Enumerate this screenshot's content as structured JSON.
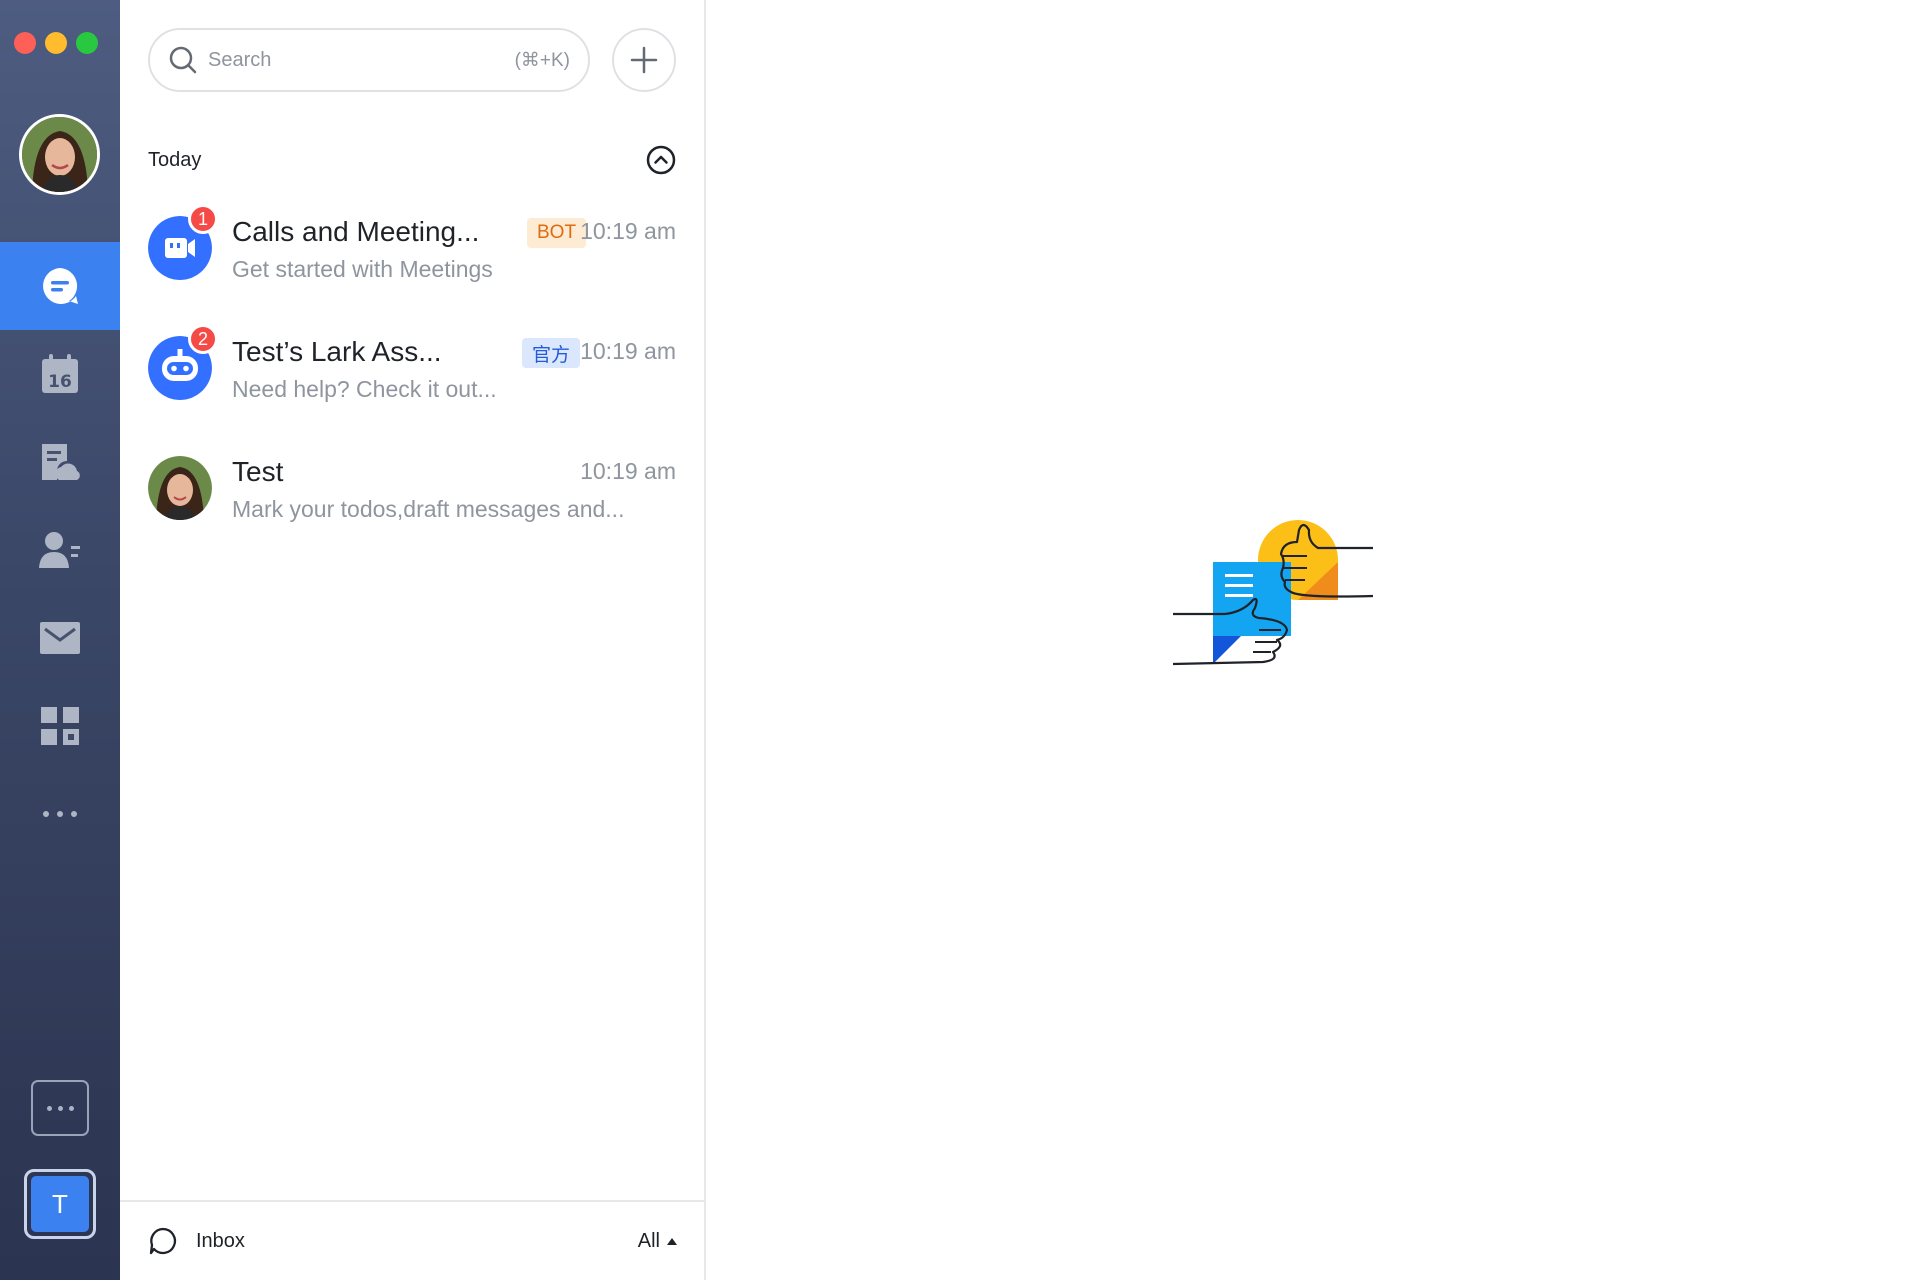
{
  "window": {
    "controls": [
      "close",
      "minimize",
      "maximize"
    ]
  },
  "rail": {
    "nav_items": [
      {
        "id": "messenger",
        "icon": "chat-icon",
        "active": true
      },
      {
        "id": "calendar",
        "icon": "calendar-icon",
        "label": "16"
      },
      {
        "id": "docs",
        "icon": "docs-cloud-icon"
      },
      {
        "id": "contacts",
        "icon": "contacts-icon"
      },
      {
        "id": "mail",
        "icon": "mail-icon"
      },
      {
        "id": "workplace",
        "icon": "apps-grid-icon"
      },
      {
        "id": "more",
        "icon": "more-icon"
      }
    ],
    "tenant_initial": "T"
  },
  "search": {
    "placeholder": "Search",
    "shortcut": "(⌘+K)"
  },
  "section": {
    "title": "Today"
  },
  "chats": [
    {
      "title": "Calls and Meeting...",
      "tag": "BOT",
      "time": "10:19 am",
      "preview": "Get started with Meetings",
      "unread": "1",
      "avatar": "video-bot-icon"
    },
    {
      "title": "Test’s Lark Ass...",
      "tag": "官方",
      "time": "10:19 am",
      "preview": "Need help? Check it out...",
      "unread": "2",
      "avatar": "robot-icon"
    },
    {
      "title": "Test",
      "time": "10:19 am",
      "preview": "Mark your todos,draft messages and...",
      "avatar": "user-photo"
    }
  ],
  "bottom_bar": {
    "label": "Inbox",
    "filter": "All"
  },
  "colors": {
    "accent": "#3b82f0",
    "badge": "#f54a45",
    "bot_tag_bg": "#fdebd4",
    "bot_tag_text": "#e06b0e",
    "official_tag_bg": "#dbe7fc",
    "official_tag_text": "#245bdb"
  }
}
